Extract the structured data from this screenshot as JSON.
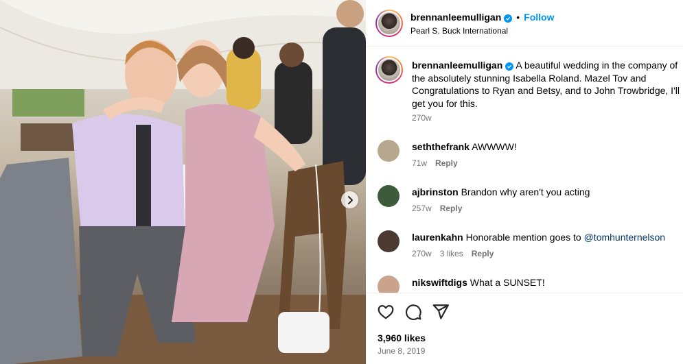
{
  "post": {
    "username": "brennanleemulligan",
    "follow_label": "Follow",
    "separator": "•",
    "location": "Pearl S. Buck International",
    "caption_text": "A beautiful wedding in the company of the absolutely stunning Isabella Roland. Mazel Tov and Congratulations to Ryan and Betsy, and to John Trowbridge, I'll get you for this.",
    "caption_time": "270w",
    "likes": "3,960 likes",
    "date": "June 8, 2019"
  },
  "comments": [
    {
      "username": "seththefrank",
      "text": "AWWWW!",
      "time": "71w",
      "likes": "",
      "reply": "Reply",
      "avatar_color": "#b8a78f"
    },
    {
      "username": "ajbrinston",
      "text": "Brandon why aren't you acting",
      "time": "257w",
      "likes": "",
      "reply": "Reply",
      "avatar_color": "#3d5b3a"
    },
    {
      "username": "laurenkahn",
      "text": "Honorable mention goes to ",
      "mention": "@tomhunternelson",
      "time": "270w",
      "likes": "3 likes",
      "reply": "Reply",
      "avatar_color": "#4a3a32"
    },
    {
      "username": "nikswiftdigs",
      "text": "What a SUNSET!",
      "time": "",
      "likes": "",
      "reply": "",
      "avatar_color": "#c9a38c"
    }
  ],
  "icons": {
    "like": "heart-icon",
    "comment": "comment-bubble-icon",
    "share": "paper-plane-icon",
    "next": "chevron-right-icon",
    "verified": "verified-badge-icon"
  },
  "colors": {
    "accent": "#0095f6",
    "secondary_text": "#737373",
    "mention": "#00376b",
    "divider": "#efefef"
  }
}
